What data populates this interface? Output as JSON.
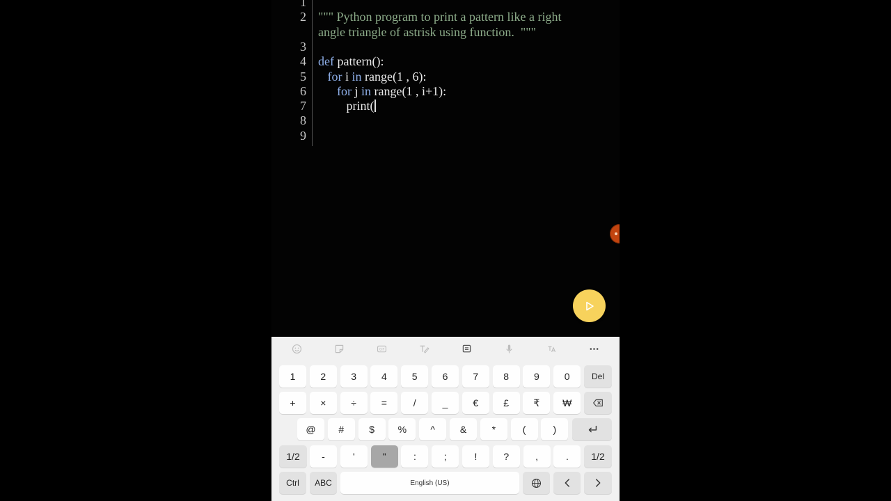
{
  "editor": {
    "lines": [
      {
        "n": "1",
        "segments": []
      },
      {
        "n": "2",
        "segments": [
          {
            "t": "\"\"\" Python program to print a pattern like a right",
            "c": "str"
          }
        ]
      },
      {
        "n": "",
        "segments": [
          {
            "t": "angle triangle of astrisk using function.  \"\"\"",
            "c": "str"
          }
        ]
      },
      {
        "n": "3",
        "segments": []
      },
      {
        "n": "4",
        "segments": [
          {
            "t": "def",
            "c": "kw"
          },
          {
            "t": " pattern():",
            "c": ""
          }
        ]
      },
      {
        "n": "5",
        "segments": [
          {
            "t": "   ",
            "c": ""
          },
          {
            "t": "for",
            "c": "kw"
          },
          {
            "t": " i ",
            "c": ""
          },
          {
            "t": "in",
            "c": "kw"
          },
          {
            "t": " range(1 , 6):",
            "c": ""
          }
        ]
      },
      {
        "n": "6",
        "segments": [
          {
            "t": "      ",
            "c": ""
          },
          {
            "t": "for",
            "c": "kw"
          },
          {
            "t": " j ",
            "c": ""
          },
          {
            "t": "in",
            "c": "kw"
          },
          {
            "t": " range(1 , i+1):",
            "c": ""
          }
        ]
      },
      {
        "n": "7",
        "segments": [
          {
            "t": "         print(",
            "c": ""
          }
        ],
        "cursor": true
      },
      {
        "n": "8",
        "segments": []
      },
      {
        "n": "9",
        "segments": []
      }
    ],
    "colors": {
      "keyword": "#8fb0ea",
      "string": "#8dac8a",
      "text": "#e9e9e9",
      "run_button": "#f7d25c"
    }
  },
  "run_button": {
    "icon": "play-icon"
  },
  "keyboard": {
    "toolbar_icons": [
      "emoji-icon",
      "sticker-icon",
      "gif-icon",
      "handwriting-icon",
      "clipboard-icon",
      "microphone-icon",
      "translate-icon",
      "more-icon"
    ],
    "rows": [
      [
        {
          "label": "1"
        },
        {
          "label": "2"
        },
        {
          "label": "3"
        },
        {
          "label": "4"
        },
        {
          "label": "5"
        },
        {
          "label": "6"
        },
        {
          "label": "7"
        },
        {
          "label": "8"
        },
        {
          "label": "9"
        },
        {
          "label": "0"
        },
        {
          "label": "Del",
          "fn": true,
          "small": true
        }
      ],
      [
        {
          "label": "+"
        },
        {
          "label": "×"
        },
        {
          "label": "÷"
        },
        {
          "label": "="
        },
        {
          "label": "/"
        },
        {
          "label": "_"
        },
        {
          "label": "€"
        },
        {
          "label": "£"
        },
        {
          "label": "₹"
        },
        {
          "label": "₩"
        },
        {
          "label": "",
          "icon": "backspace-icon",
          "fn": true
        }
      ],
      [
        {
          "label": "@"
        },
        {
          "label": "#"
        },
        {
          "label": "$"
        },
        {
          "label": "%"
        },
        {
          "label": "^"
        },
        {
          "label": "&"
        },
        {
          "label": "*"
        },
        {
          "label": "("
        },
        {
          "label": ")"
        },
        {
          "label": "",
          "icon": "enter-icon",
          "fn": true
        }
      ],
      [
        {
          "label": "1/2",
          "fn": true
        },
        {
          "label": "-"
        },
        {
          "label": "'"
        },
        {
          "label": "\"",
          "pressed": true
        },
        {
          "label": ":"
        },
        {
          "label": ";"
        },
        {
          "label": "!"
        },
        {
          "label": "?"
        },
        {
          "label": ","
        },
        {
          "label": "."
        },
        {
          "label": "1/2",
          "fn": true
        }
      ],
      [
        {
          "label": "Ctrl",
          "fn": true,
          "small": true
        },
        {
          "label": "ABC",
          "fn": true,
          "small": true
        },
        {
          "label": "English (US)",
          "tiny": true,
          "space": true
        },
        {
          "label": "",
          "icon": "globe-icon",
          "fn": true
        },
        {
          "label": "",
          "icon": "arrow-left-icon",
          "fn": true
        },
        {
          "label": "",
          "icon": "arrow-right-icon",
          "fn": true
        }
      ]
    ]
  }
}
